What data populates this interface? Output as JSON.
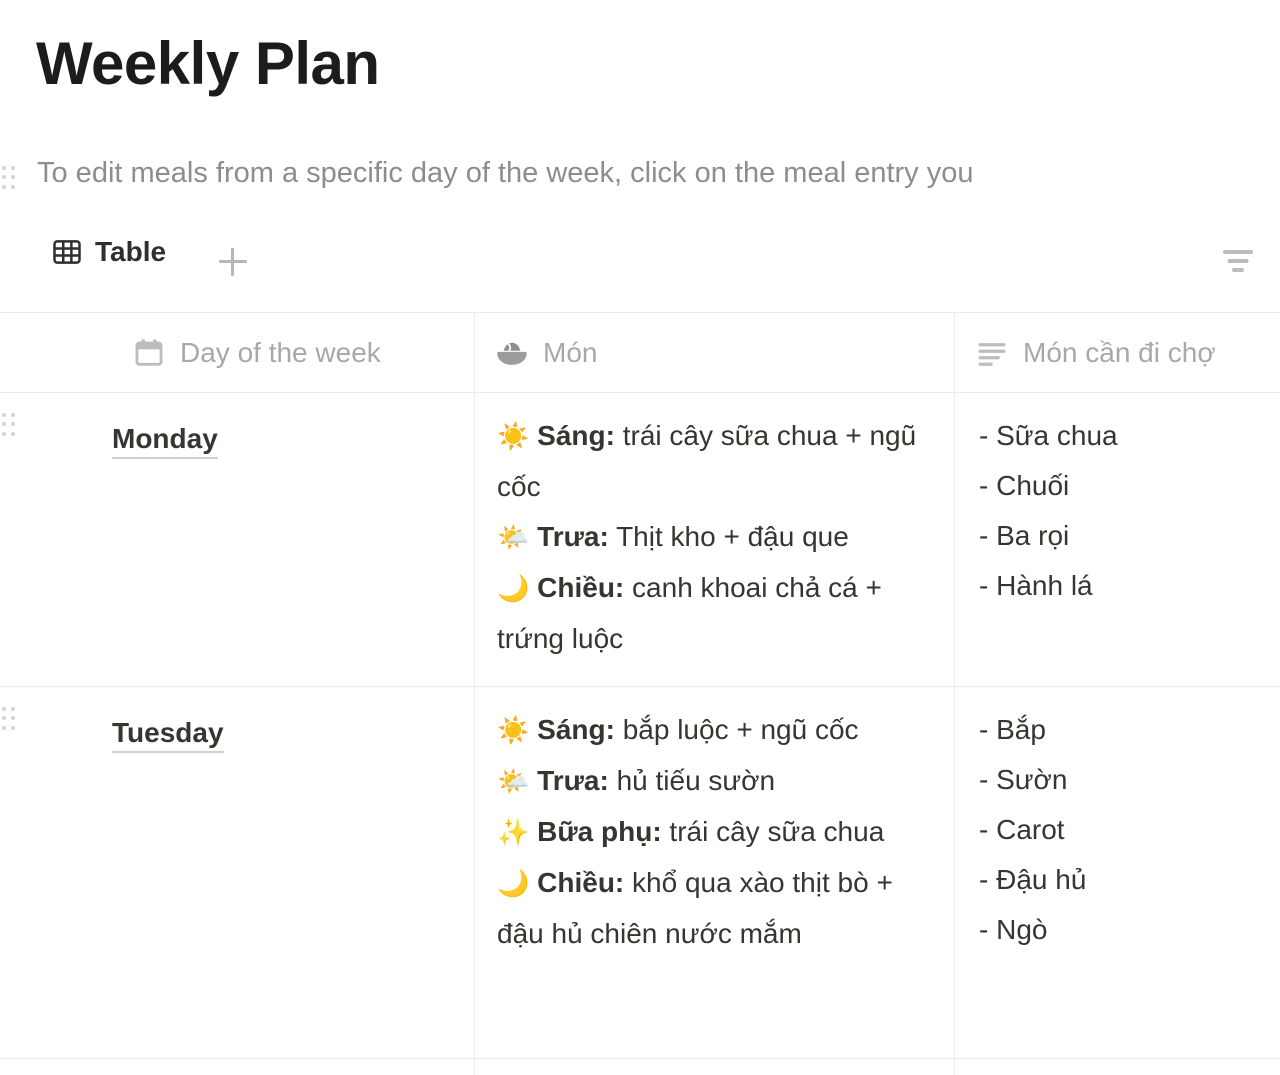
{
  "page": {
    "title": "Weekly Plan",
    "description": "To edit meals from a specific day of the week, click on the meal entry you"
  },
  "toolbar": {
    "view_tab_label": "Table",
    "view_tab_icon": "table-grid-icon",
    "add_view_icon": "plus-icon",
    "filter_icon": "filter-icon"
  },
  "table": {
    "columns": [
      {
        "label": "Day of the week",
        "icon": "calendar-icon"
      },
      {
        "label": "Món",
        "icon": "rice-bowl-icon"
      },
      {
        "label": "Món cần đi chợ",
        "icon": "text-lines-icon"
      }
    ],
    "rows": [
      {
        "day": "Monday",
        "meals": [
          {
            "emoji": "☀️",
            "label": "Sáng:",
            "text": " trái cây sữa chua + ngũ cốc"
          },
          {
            "emoji": "🌤️",
            "label": "Trưa:",
            "text": " Thịt kho + đậu que"
          },
          {
            "emoji": "🌙",
            "label": "Chiều:",
            "text": " canh khoai chả cá + trứng luộc"
          }
        ],
        "shopping": [
          "- Sữa chua",
          "- Chuối",
          "- Ba rọi",
          "- Hành lá"
        ]
      },
      {
        "day": "Tuesday",
        "meals": [
          {
            "emoji": "☀️",
            "label": "Sáng:",
            "text": " bắp luộc + ngũ cốc"
          },
          {
            "emoji": "🌤️",
            "label": "Trưa:",
            "text": " hủ tiếu sườn"
          },
          {
            "emoji": "✨",
            "label": "Bữa phụ:",
            "text": " trái cây sữa chua"
          },
          {
            "emoji": "🌙",
            "label": "Chiều:",
            "text": " khổ qua xào thịt bò + đậu hủ chiên nước mắm"
          }
        ],
        "shopping": [
          "- Bắp",
          "- Sườn",
          "- Carot",
          "- Đậu hủ",
          "- Ngò"
        ]
      }
    ]
  },
  "colors": {
    "title": "#1c1c1e",
    "body_text": "#37352f",
    "muted_text": "#a8a8a5",
    "description_text": "#8d8d89",
    "border": "#ececeb",
    "background": "#ffffff"
  }
}
